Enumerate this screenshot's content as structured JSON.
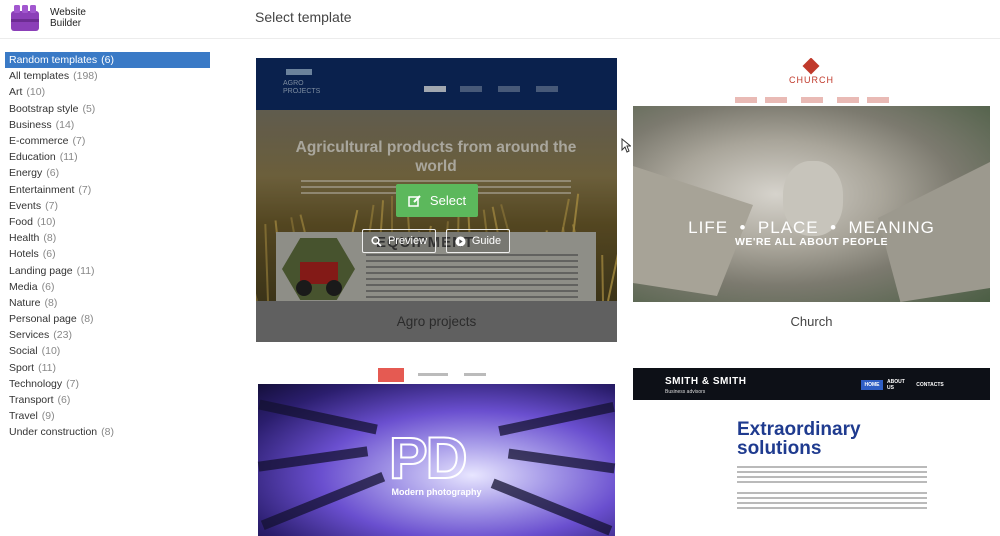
{
  "header": {
    "logo_line1": "Website",
    "logo_line2": "Builder",
    "page_title": "Select template"
  },
  "sidebar": {
    "categories": [
      {
        "name": "Random templates",
        "count": "(6)",
        "active": true
      },
      {
        "name": "All templates",
        "count": "(198)"
      },
      {
        "name": "Art",
        "count": "(10)"
      },
      {
        "name": "Bootstrap style",
        "count": "(5)"
      },
      {
        "name": "Business",
        "count": "(14)"
      },
      {
        "name": "E-commerce",
        "count": "(7)"
      },
      {
        "name": "Education",
        "count": "(11)"
      },
      {
        "name": "Energy",
        "count": "(6)"
      },
      {
        "name": "Entertainment",
        "count": "(7)"
      },
      {
        "name": "Events",
        "count": "(7)"
      },
      {
        "name": "Food",
        "count": "(10)"
      },
      {
        "name": "Health",
        "count": "(8)"
      },
      {
        "name": "Hotels",
        "count": "(6)"
      },
      {
        "name": "Landing page",
        "count": "(11)"
      },
      {
        "name": "Media",
        "count": "(6)"
      },
      {
        "name": "Nature",
        "count": "(8)"
      },
      {
        "name": "Personal page",
        "count": "(8)"
      },
      {
        "name": "Services",
        "count": "(23)"
      },
      {
        "name": "Social",
        "count": "(10)"
      },
      {
        "name": "Sport",
        "count": "(11)"
      },
      {
        "name": "Technology",
        "count": "(7)"
      },
      {
        "name": "Transport",
        "count": "(6)"
      },
      {
        "name": "Travel",
        "count": "(9)"
      },
      {
        "name": "Under construction",
        "count": "(8)"
      }
    ]
  },
  "templates": {
    "agro": {
      "label": "Agro projects",
      "preview_logo": "AGRO\nPROJECTS",
      "preview_heading": "Agricultural products from around the world",
      "preview_panel_heading": "EQUIPMENT",
      "select_label": "Select",
      "preview_label": "Preview",
      "guide_label": "Guide"
    },
    "church": {
      "label": "Church",
      "preview_title": "CHURCH",
      "preview_tagline": "LIFE  •  PLACE  •  MEANING",
      "preview_subtagline": "WE'RE ALL ABOUT PEOPLE"
    },
    "pd": {
      "logo": "PD",
      "subtitle": "Modern photography"
    },
    "smith": {
      "brand": "SMITH & SMITH",
      "tagline": "Business advisors",
      "menu": [
        "HOME",
        "ABOUT US",
        "CONTACTS"
      ],
      "heading": "Extraordinary\nsolutions"
    }
  },
  "colors": {
    "active_category": "#3a7ac6",
    "select_button": "#5cb85c",
    "church_accent": "#c0392b",
    "smith_heading": "#1f3b8f"
  }
}
